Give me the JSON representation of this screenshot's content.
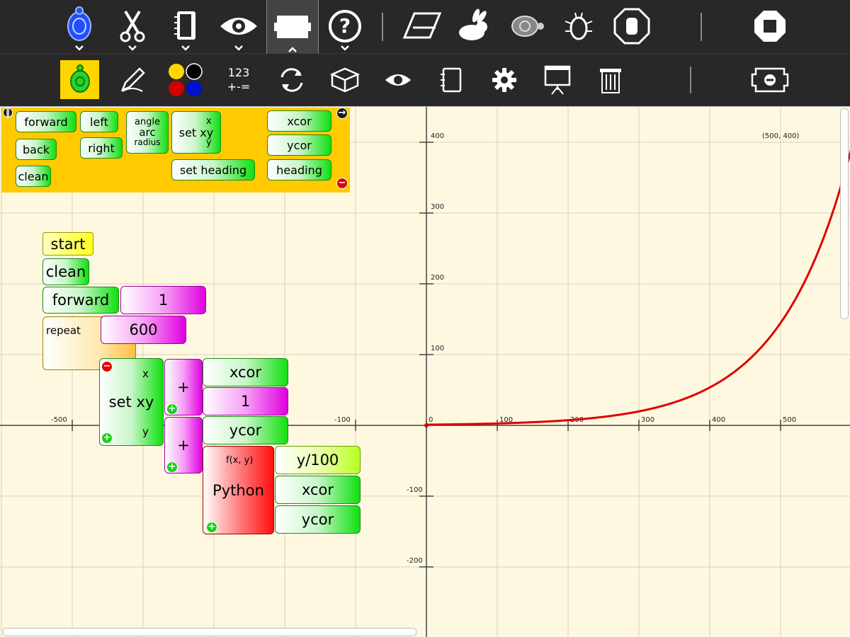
{
  "top_toolbar": {
    "items": [
      {
        "name": "activity-turtle-icon"
      },
      {
        "name": "edit-scissors-icon"
      },
      {
        "name": "notebook-icon"
      },
      {
        "name": "view-eye-icon"
      },
      {
        "name": "palette-toggle-icon"
      },
      {
        "name": "help-icon"
      },
      {
        "name": "eraser-icon"
      },
      {
        "name": "rabbit-fast-icon"
      },
      {
        "name": "turtle-slow-icon"
      },
      {
        "name": "bug-debug-icon"
      },
      {
        "name": "stop-hand-icon"
      },
      {
        "name": "stop-activity-icon"
      }
    ]
  },
  "second_toolbar": {
    "numbers_label_top": "123",
    "numbers_label_bottom": "+-=",
    "items": [
      {
        "name": "turtle-palette-icon"
      },
      {
        "name": "pen-palette-icon"
      },
      {
        "name": "colors-palette-icon"
      },
      {
        "name": "numbers-palette"
      },
      {
        "name": "flow-palette-icon"
      },
      {
        "name": "blocks-palette-icon"
      },
      {
        "name": "sensors-palette-icon"
      },
      {
        "name": "media-palette-icon"
      },
      {
        "name": "extras-palette-icon"
      },
      {
        "name": "portfolio-palette-icon"
      },
      {
        "name": "trash-palette-icon"
      },
      {
        "name": "hide-palette-icon"
      }
    ]
  },
  "palette": {
    "forward": "forward",
    "left": "left",
    "right": "right",
    "back": "back",
    "clean": "clean",
    "arc": "arc",
    "angle": "angle",
    "radius": "radius",
    "setxy": "set xy",
    "x": "x",
    "y": "y",
    "xcor": "xcor",
    "ycor": "ycor",
    "setheading": "set heading",
    "heading": "heading"
  },
  "program": {
    "start": "start",
    "clean": "clean",
    "forward": "forward",
    "forward_val": "1",
    "repeat": "repeat",
    "repeat_val": "600",
    "setxy": "set xy",
    "x": "x",
    "y": "y",
    "plus": "+",
    "xcor": "xcor",
    "one": "1",
    "ycor": "ycor",
    "python": "Python",
    "fxy": "f(x, y)",
    "expr": "y/100",
    "xcor2": "xcor",
    "ycor2": "ycor"
  },
  "graph": {
    "x_ticks": [
      "-500",
      "-100",
      "0",
      "100",
      "200",
      "300",
      "400",
      "500"
    ],
    "y_ticks": [
      "400",
      "300",
      "200",
      "100",
      "-100",
      "-200"
    ],
    "corner_label": "(500, 400)",
    "curve_color": "#dd0000",
    "grid_color": "#d8d0b8"
  }
}
